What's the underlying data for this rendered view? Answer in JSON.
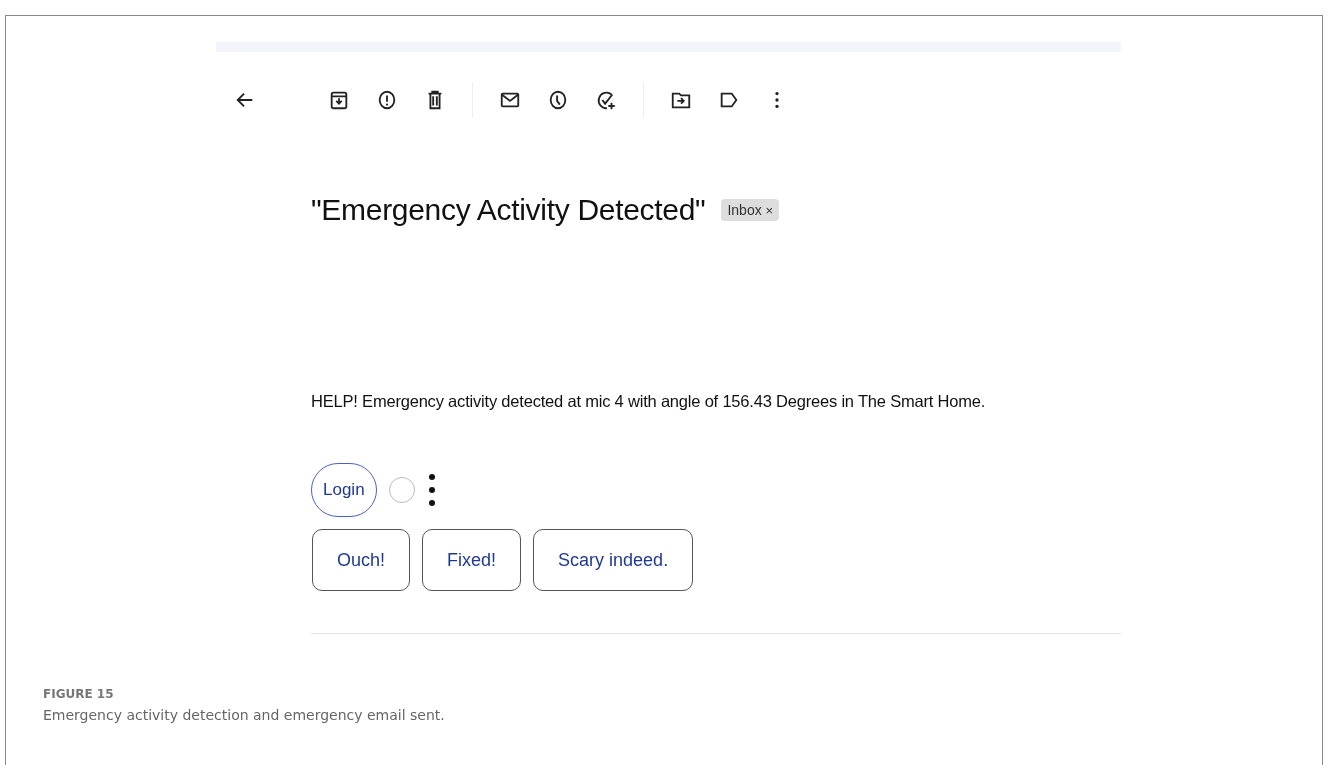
{
  "email": {
    "subject": "\"Emergency Activity Detected\"",
    "label": {
      "text": "Inbox",
      "remove": "×"
    },
    "body": "HELP! Emergency activity detected at mic 4 with angle of 156.43 Degrees in The Smart Home.",
    "chip": {
      "label": "Login"
    },
    "smart_replies": [
      "Ouch!",
      "Fixed!",
      "Scary indeed."
    ]
  },
  "caption": {
    "number": "FIGURE 15",
    "text": "Emergency activity detection and emergency email sent."
  }
}
